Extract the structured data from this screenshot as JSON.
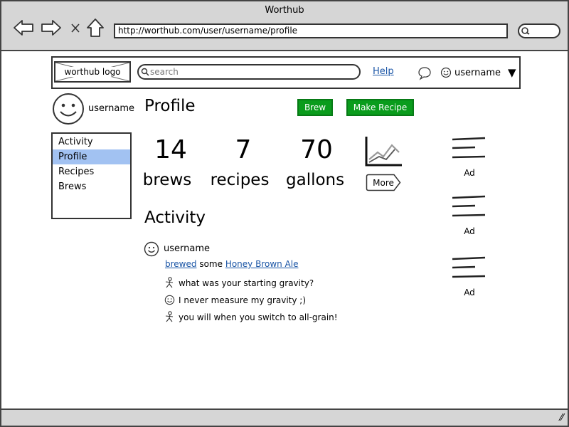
{
  "browser": {
    "window_title": "Worthub",
    "url": "http://worthub.com/user/username/profile"
  },
  "header": {
    "logo": "worthub logo",
    "search_placeholder": "search",
    "help": "Help",
    "username": "username"
  },
  "sidebar": {
    "username": "username",
    "items": [
      {
        "label": "Activity",
        "active": false
      },
      {
        "label": "Profile",
        "active": true
      },
      {
        "label": "Recipes",
        "active": false
      },
      {
        "label": "Brews",
        "active": false
      }
    ]
  },
  "main": {
    "title": "Profile",
    "brew_button": "Brew",
    "make_recipe_button": "Make Recipe",
    "stats": [
      {
        "value": "14",
        "label": "brews"
      },
      {
        "value": "7",
        "label": "recipes"
      },
      {
        "value": "70",
        "label": "gallons"
      }
    ],
    "more_button": "More",
    "activity_title": "Activity"
  },
  "activity": {
    "username": "username",
    "action_link": "brewed",
    "action_text": "some",
    "item_link": "Honey Brown Ale",
    "comments": [
      {
        "icon": "stick-figure-icon",
        "text": "what was your starting gravity?"
      },
      {
        "icon": "smiley-icon",
        "text": "I never measure my gravity ;)"
      },
      {
        "icon": "stick-figure-icon",
        "text": "you will when you switch to all-grain!"
      }
    ]
  },
  "ads": [
    "Ad",
    "Ad",
    "Ad"
  ],
  "colors": {
    "accent_green": "#0a9c1c",
    "selected_nav": "#a2c2f2",
    "link": "#1a55a6",
    "chrome": "#d6d6d6"
  }
}
